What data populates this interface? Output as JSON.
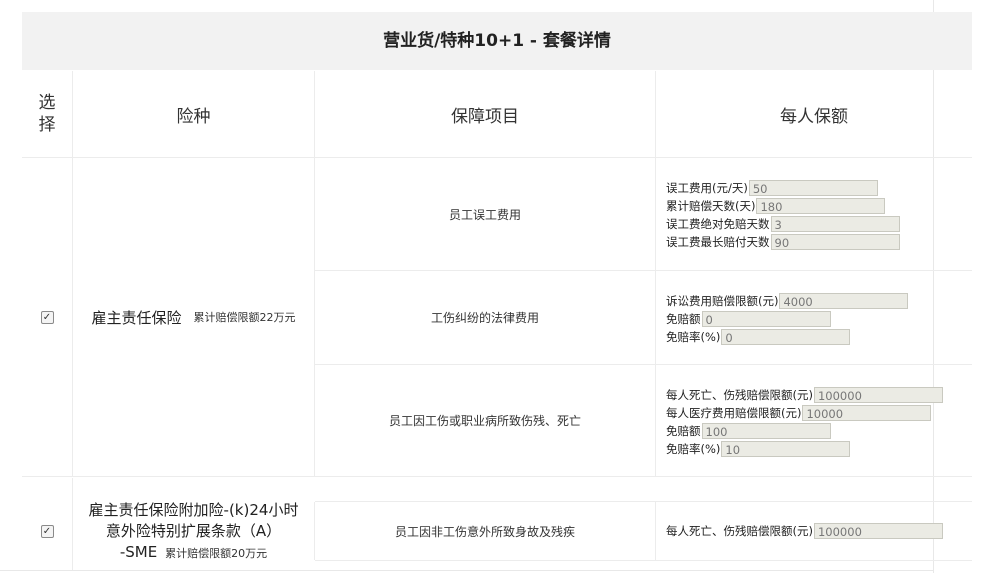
{
  "title": "营业货/特种10+1 - 套餐详情",
  "headers": {
    "select_line1": "选",
    "select_line2": "择",
    "insurance_type": "险种",
    "coverage_item": "保障项目",
    "per_person_amount": "每人保额"
  },
  "rows": [
    {
      "checked": "✓",
      "type_name": "雇主责任保险",
      "limit": "累计赔偿限额22万元",
      "items": [
        {
          "label": "员工误工费用",
          "fields": [
            {
              "label": "误工费用(元/天)",
              "value": "50"
            },
            {
              "label": "累计赔偿天数(天)",
              "value": "180"
            },
            {
              "label": "误工费绝对免赔天数",
              "value": "3"
            },
            {
              "label": "误工费最长赔付天数",
              "value": "90"
            }
          ]
        },
        {
          "label": "工伤纠纷的法律费用",
          "fields": [
            {
              "label": "诉讼费用赔偿限额(元)",
              "value": "4000"
            },
            {
              "label": "免赔额",
              "value": "0"
            },
            {
              "label": "免赔率(%)",
              "value": "0"
            }
          ]
        },
        {
          "label": "员工因工伤或职业病所致伤残、死亡",
          "fields": [
            {
              "label": "每人死亡、伤残赔偿限额(元)",
              "value": "100000"
            },
            {
              "label": "每人医疗费用赔偿限额(元)",
              "value": "10000"
            },
            {
              "label": "免赔额",
              "value": "100"
            },
            {
              "label": "免赔率(%)",
              "value": "10"
            }
          ]
        }
      ]
    },
    {
      "checked": "✓",
      "type_name_line1": "雇主责任保险附加险-(k)24小时",
      "type_name_line2": "意外险特别扩展条款（A）",
      "type_name_line3": "-SME",
      "limit": "累计赔偿限额20万元",
      "items": [
        {
          "label": "员工因非工伤意外所致身故及残疾",
          "fields": [
            {
              "label": "每人死亡、伤残赔偿限额(元)",
              "value": "100000"
            }
          ]
        }
      ]
    }
  ]
}
